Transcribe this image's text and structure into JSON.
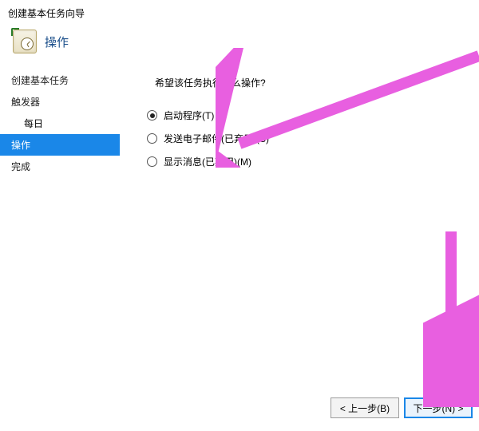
{
  "window": {
    "title": "创建基本任务向导",
    "subtitle": "操作"
  },
  "sidebar": {
    "items": [
      {
        "label": "创建基本任务",
        "type": "item"
      },
      {
        "label": "触发器",
        "type": "item"
      },
      {
        "label": "每日",
        "type": "subitem"
      },
      {
        "label": "操作",
        "type": "item",
        "active": true
      },
      {
        "label": "完成",
        "type": "item"
      }
    ]
  },
  "content": {
    "question": "希望该任务执行什么操作?",
    "options": [
      {
        "label": "启动程序(T)",
        "checked": true
      },
      {
        "label": "发送电子邮件(已弃用)(S)",
        "checked": false
      },
      {
        "label": "显示消息(已弃用)(M)",
        "checked": false
      }
    ]
  },
  "footer": {
    "back": "< 上一步(B)",
    "next": "下一步(N) >"
  },
  "annotation": {
    "arrow_color": "#e85fe0"
  }
}
